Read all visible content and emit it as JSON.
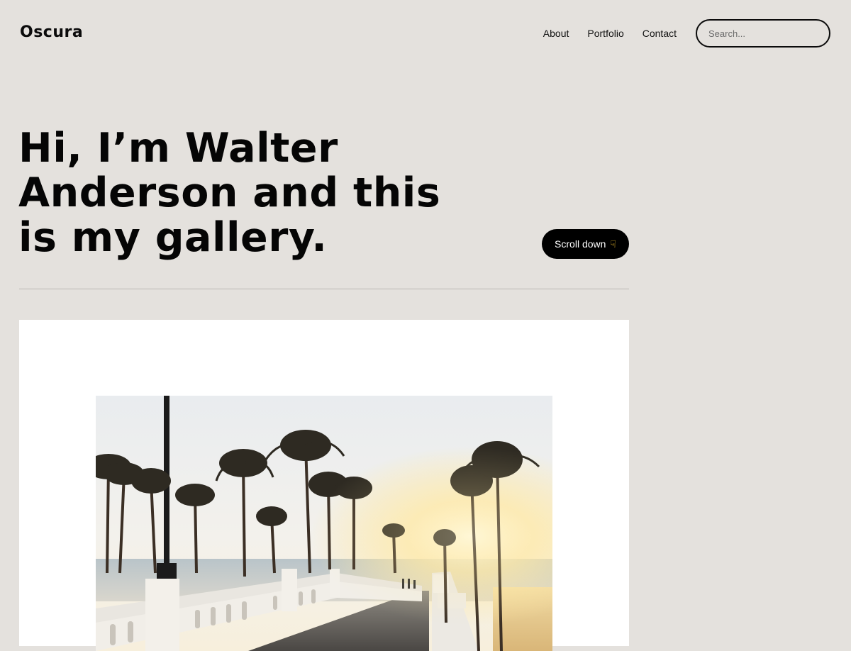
{
  "header": {
    "logo": "Oscura",
    "nav": [
      {
        "label": "About"
      },
      {
        "label": "Portfolio"
      },
      {
        "label": "Contact"
      }
    ],
    "search": {
      "placeholder": "Search..."
    }
  },
  "hero": {
    "title": "Hi, I’m Walter Anderson and this is my gallery.",
    "scroll_label": "Scroll down",
    "scroll_icon": "pointing-down-hand-icon"
  },
  "gallery": {
    "featured_photo": "pier-with-palm-trees-at-sunset-photo"
  },
  "colors": {
    "background": "#e4e1dd",
    "text": "#050505",
    "card": "#ffffff",
    "button": "#000000"
  }
}
